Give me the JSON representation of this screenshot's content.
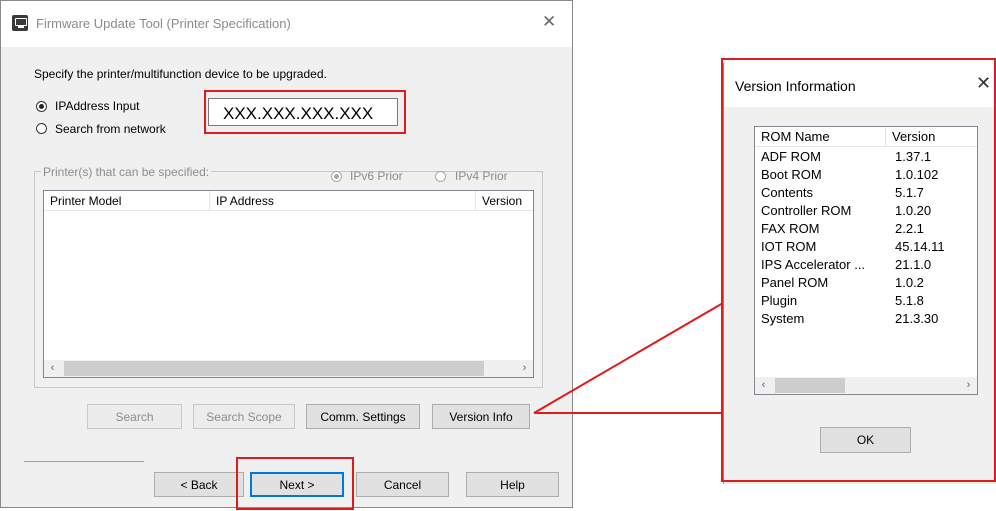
{
  "main_window": {
    "title": "Firmware Update Tool (Printer Specification)",
    "close_glyph": "✕",
    "instruction": "Specify the printer/multifunction device to be upgraded.",
    "radio_ip_label": "IPAddress Input",
    "radio_search_label": "Search from network",
    "ip_value": "XXX.XXX.XXX.XXX",
    "group_caption": "Printer(s) that can be specified:",
    "ipv6_label": "IPv6 Prior",
    "ipv4_label": "IPv4 Prior",
    "columns": [
      "Printer Model",
      "IP Address",
      "Version"
    ],
    "buttons": {
      "search": "Search",
      "search_scope": "Search Scope",
      "comm_settings": "Comm. Settings",
      "version_info": "Version Info",
      "back": "< Back",
      "next": "Next >",
      "cancel": "Cancel",
      "help": "Help"
    },
    "selected_radio": "IPAddress Input",
    "selected_ip_priority": "IPv6 Prior"
  },
  "version_window": {
    "title": "Version Information",
    "close_glyph": "✕",
    "columns": [
      "ROM Name",
      "Version"
    ],
    "rows": [
      {
        "name": "ADF ROM",
        "version": "1.37.1"
      },
      {
        "name": "Boot ROM",
        "version": "1.0.102"
      },
      {
        "name": "Contents",
        "version": "5.1.7"
      },
      {
        "name": "Controller ROM",
        "version": "1.0.20"
      },
      {
        "name": "FAX ROM",
        "version": "2.2.1"
      },
      {
        "name": "IOT ROM",
        "version": "45.14.11"
      },
      {
        "name": "IPS Accelerator ...",
        "version": "21.1.0"
      },
      {
        "name": "Panel ROM",
        "version": "1.0.2"
      },
      {
        "name": "Plugin",
        "version": "5.1.8"
      },
      {
        "name": "System",
        "version": "21.3.30"
      }
    ],
    "ok_label": "OK"
  },
  "colors": {
    "highlight": "#e01b1b",
    "dialog_bg": "#f0f0f0",
    "disabled_text": "#8c8c8c"
  },
  "icons": {
    "scroll_left": "‹",
    "scroll_right": "›"
  }
}
